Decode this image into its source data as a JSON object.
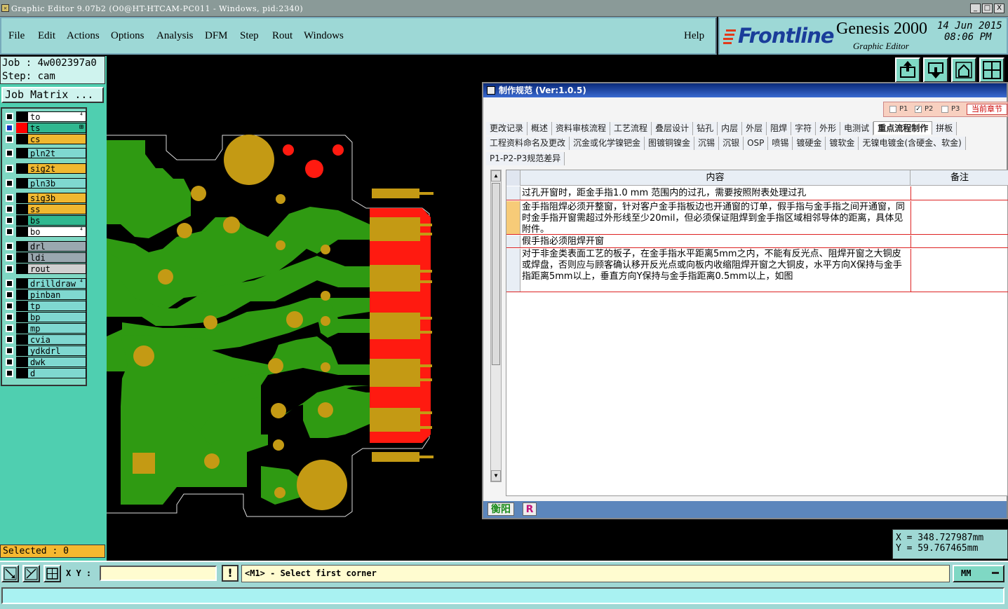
{
  "window": {
    "title": "Graphic Editor 9.07b2 (O0@HT-HTCAM-PC011 - Windows, pid:2340)",
    "minimize": "_",
    "maximize": "□",
    "close": "X"
  },
  "menubar": {
    "items": [
      "File",
      "Edit",
      "Actions",
      "Options",
      "Analysis",
      "DFM",
      "Step",
      "Rout",
      "Windows"
    ],
    "help": "Help"
  },
  "brand": {
    "logo": "Frontline",
    "product": "Genesis 2000",
    "subtitle": "Graphic Editor",
    "date": "14 Jun 2015",
    "time": "08:06 PM"
  },
  "job": {
    "job_line": "Job : 4w002397a0",
    "step_line": "Step: cam",
    "matrix_button": "Job Matrix ..."
  },
  "layers": [
    {
      "name": "to",
      "color": "#ffffff",
      "swatch": "#000000",
      "mark": "⁴"
    },
    {
      "name": "ts",
      "color": "#30b890",
      "swatch": "#ff0000",
      "mark": "⊞",
      "selected": true
    },
    {
      "name": "cs",
      "color": "#f0b830",
      "swatch": "#000000"
    },
    {
      "name": "pln2t",
      "color": "#7fd8d0",
      "swatch": "#000000"
    },
    {
      "name": "sig2t",
      "color": "#f0b830",
      "swatch": "#000000"
    },
    {
      "name": "pln3b",
      "color": "#7fd8d0",
      "swatch": "#000000"
    },
    {
      "name": "sig3b",
      "color": "#f0b830",
      "swatch": "#000000"
    },
    {
      "name": "ss",
      "color": "#f0b830",
      "swatch": "#000000"
    },
    {
      "name": "bs",
      "color": "#30b890",
      "swatch": "#000000"
    },
    {
      "name": "bo",
      "color": "#ffffff",
      "swatch": "#000000",
      "mark": "⁴"
    },
    {
      "name": "drl",
      "color": "#9aa8b0",
      "swatch": "#000000"
    },
    {
      "name": "ldi",
      "color": "#9aa8b0",
      "swatch": "#000000"
    },
    {
      "name": "rout",
      "color": "#d0d0d0",
      "swatch": "#000000"
    },
    {
      "name": "drilldraw",
      "color": "#7fd8d0",
      "swatch": "#000000",
      "mark": "⁴"
    },
    {
      "name": "pinban",
      "color": "#7fd8d0",
      "swatch": "#000000"
    },
    {
      "name": "tp",
      "color": "#7fd8d0",
      "swatch": "#000000"
    },
    {
      "name": "bp",
      "color": "#7fd8d0",
      "swatch": "#000000"
    },
    {
      "name": "mp",
      "color": "#7fd8d0",
      "swatch": "#000000"
    },
    {
      "name": "cvia",
      "color": "#7fd8d0",
      "swatch": "#000000"
    },
    {
      "name": "ydkdrl",
      "color": "#7fd8d0",
      "swatch": "#000000"
    },
    {
      "name": "dwk",
      "color": "#7fd8d0",
      "swatch": "#000000"
    },
    {
      "name": "d",
      "color": "#7fd8d0",
      "swatch": "#000000"
    }
  ],
  "selected_label": "Selected : 0",
  "spec_window": {
    "title": "制作规范 (Ver:1.0.5)",
    "pages": [
      {
        "label": "P1",
        "checked": false
      },
      {
        "label": "P2",
        "checked": true
      },
      {
        "label": "P3",
        "checked": false
      }
    ],
    "current_section": "当前章节",
    "tabs_row1": [
      "更改记录",
      "概述",
      "资料审核流程",
      "工艺流程",
      "叠层设计",
      "钻孔",
      "内层",
      "外层",
      "阻焊",
      "字符",
      "外形",
      "电测试",
      "重点流程制作",
      "拼板"
    ],
    "active_tab": "重点流程制作",
    "tabs_row2": [
      "工程资料命名及更改",
      "沉金或化学镍钯金",
      "图镀铜镍金",
      "沉锡",
      "沉银",
      "OSP",
      "喷锡",
      "镀硬金",
      "镀软金",
      "无镍电镀金(含硬金、软金)"
    ],
    "tabs_row3": [
      "P1-P2-P3规范差异"
    ],
    "columns": {
      "content": "内容",
      "note": "备注"
    },
    "rows": [
      {
        "content": "过孔开窗时，距金手指1.0 mm 范围内的过孔，需要按照附表处理过孔",
        "note": ""
      },
      {
        "content": "金手指阻焊必须开整窗，针对客户金手指板边也开通窗的订单，假手指与金手指之间开通窗，同时金手指开窗需超过外形线至少20mil，但必须保证阻焊到金手指区域相邻导体的距离，具体见附件。",
        "note": ""
      },
      {
        "content": "假手指必须阻焊开窗",
        "note": ""
      },
      {
        "content": "对于非金类表面工艺的板子，在金手指水平距离5mm之内，不能有反光点、阻焊开窗之大铜皮或焊盘，否则应与顾客确认移开反光点或向板内收缩阻焊开窗之大铜皮，水平方向X保持与金手指距离5mm以上，垂直方向Y保持与金手指距离0.5mm以上，如图",
        "note": ""
      }
    ],
    "footer_user": "衡阳",
    "footer_r": "R"
  },
  "coords": {
    "x": "X  =  348.727987mm",
    "y": "Y  =  59.767465mm"
  },
  "bottom": {
    "xy_label": "X Y :",
    "xy_value": "",
    "status": "<M1> - Select first corner",
    "units": "MM",
    "warn": "!"
  },
  "colors": {
    "copper_green": "#2f9a12",
    "pad_gold": "#c49a14",
    "mask_red": "#ff1a10",
    "panel_teal": "#4fcfb0",
    "menubar": "#9dd8d6"
  }
}
